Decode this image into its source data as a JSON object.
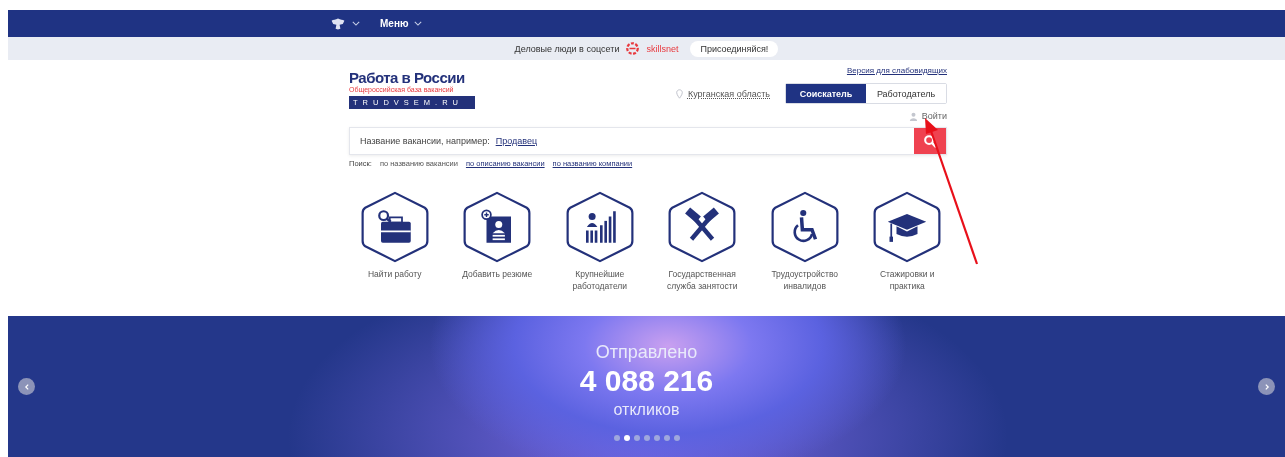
{
  "top_nav": {
    "menu_label": "Меню"
  },
  "promo_bar": {
    "text": "Деловые люди в соцсети",
    "brand": "skillsnet",
    "button": "Присоединяйся!"
  },
  "header": {
    "logo_title": "Работа в России",
    "logo_subtitle": "Общероссийская база вакансий",
    "logo_domain": "TRUDVSEM.RU",
    "accessibility_link": "Версия для слабовидящих",
    "region": "Курганская область",
    "roles": [
      {
        "label": "Соискатель",
        "selected": true
      },
      {
        "label": "Работодатель",
        "selected": false
      }
    ],
    "login": "Войти"
  },
  "search": {
    "placeholder": "Название вакансии, например:",
    "example": "Продавец",
    "mode_label": "Поиск:",
    "modes": [
      {
        "label": "по названию вакансии",
        "selected": true
      },
      {
        "label": "по описанию вакансии",
        "selected": false
      },
      {
        "label": "по названию компании",
        "selected": false
      }
    ]
  },
  "categories": [
    {
      "kind": "briefcase",
      "label": "Найти работу"
    },
    {
      "kind": "resume",
      "label": "Добавить резюме"
    },
    {
      "kind": "chart",
      "label": "Крупнейшие работодатели"
    },
    {
      "kind": "hammers",
      "label": "Государственная служба занятости"
    },
    {
      "kind": "wheelchair",
      "label": "Трудоустройство инвалидов"
    },
    {
      "kind": "cap",
      "label": "Стажировки и практика"
    }
  ],
  "banner": {
    "line1": "Отправлено",
    "number": "4 088 216",
    "line2": "откликов",
    "dots": [
      {
        "selected": false
      },
      {
        "selected": true
      },
      {
        "selected": false
      },
      {
        "selected": false
      },
      {
        "selected": false
      },
      {
        "selected": false
      },
      {
        "selected": false
      }
    ]
  }
}
